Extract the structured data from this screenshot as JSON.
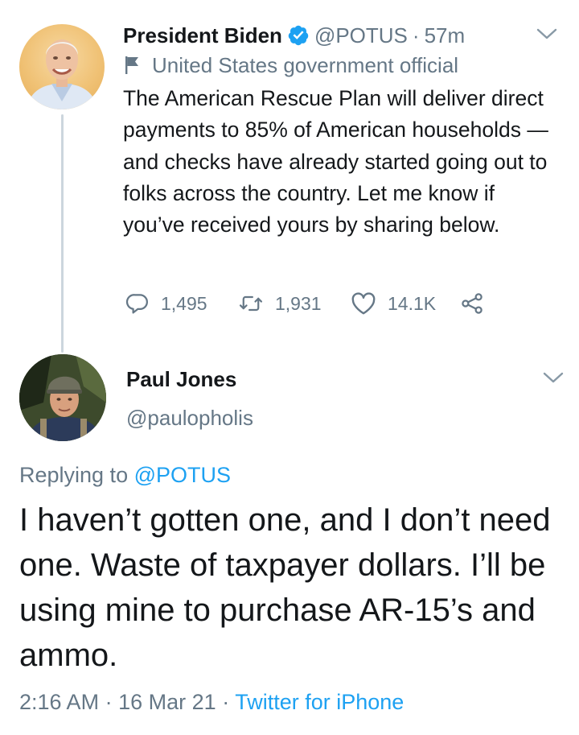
{
  "parent_tweet": {
    "author_name": "President Biden",
    "handle": "@POTUS",
    "separator": "·",
    "time_ago": "57m",
    "account_label": "United States government official",
    "text": "The American Rescue Plan will deliver direct payments to 85% of American households — and checks have already started going out to folks across the country. Let me know if you’ve received yours by sharing below.",
    "reply_count": "1,495",
    "retweet_count": "1,931",
    "like_count": "14.1K"
  },
  "reply_tweet": {
    "author_name": "Paul Jones",
    "handle": "@paulopholis",
    "replying_prefix": "Replying to",
    "replying_to": "@POTUS",
    "text": "I haven’t gotten one, and I don’t need one.  Waste of taxpayer dollars.  I’ll be using mine to purchase AR-15’s and ammo.",
    "time": "2:16 AM",
    "separator": "·",
    "date": "16 Mar 21",
    "separator2": "·",
    "source": "Twitter for iPhone"
  },
  "colors": {
    "text": "#14171a",
    "muted": "#657786",
    "link": "#1da1f2",
    "thread_line": "#ccd6dd"
  },
  "icons": [
    "verified-badge-icon",
    "flag-icon",
    "reply-icon",
    "retweet-icon",
    "like-icon",
    "share-icon",
    "chevron-down-icon"
  ]
}
